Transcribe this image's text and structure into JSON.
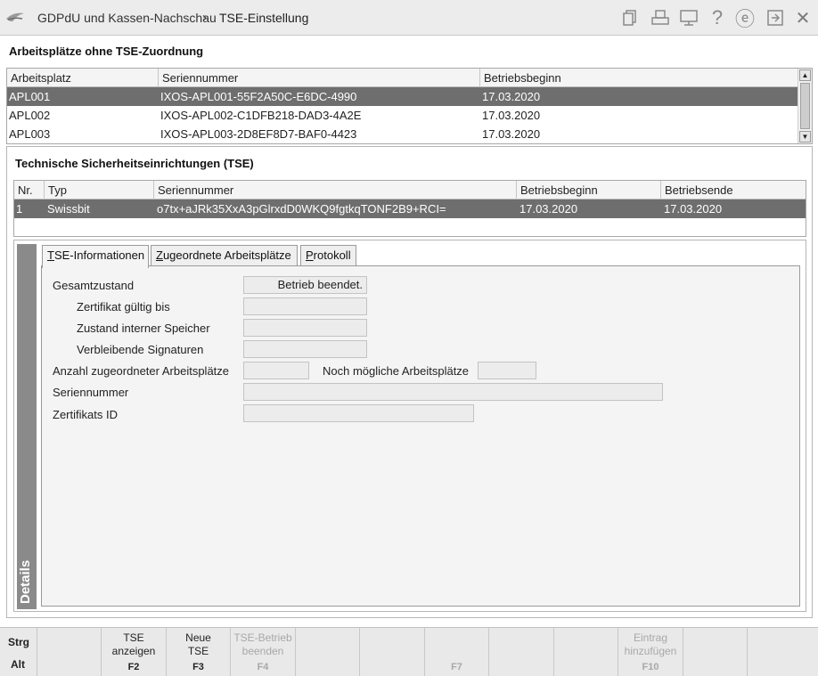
{
  "header": {
    "breadcrumb_parent": "GDPdU und Kassen-Nachschau",
    "breadcrumb_separator": "›",
    "breadcrumb_current": "TSE-Einstellung",
    "icons": [
      "documents-icon",
      "printer-icon",
      "monitor-icon",
      "help-icon",
      "e-icon",
      "export-icon",
      "close-icon"
    ],
    "help_glyph": "?",
    "e_glyph": "ⓔ",
    "close_glyph": "✕"
  },
  "workstations": {
    "title": "Arbeitsplätze ohne TSE-Zuordnung",
    "columns": [
      "Arbeitsplatz",
      "Seriennummer",
      "Betriebsbeginn"
    ],
    "rows": [
      {
        "workstation": "APL001",
        "serial": "IXOS-APL001-55F2A50C-E6DC-4990",
        "start": "17.03.2020",
        "selected": true
      },
      {
        "workstation": "APL002",
        "serial": "IXOS-APL002-C1DFB218-DAD3-4A2E",
        "start": "17.03.2020",
        "selected": false
      },
      {
        "workstation": "APL003",
        "serial": "IXOS-APL003-2D8EF8D7-BAF0-4423",
        "start": "17.03.2020",
        "selected": false
      }
    ]
  },
  "tse": {
    "title": "Technische Sicherheitseinrichtungen (TSE)",
    "columns": [
      "Nr.",
      "Typ",
      "Seriennummer",
      "Betriebsbeginn",
      "Betriebsende"
    ],
    "rows": [
      {
        "nr": "1",
        "type": "Swissbit",
        "serial": "o7tx+aJRk35XxA3pGlrxdD0WKQ9fgtkqTONF2B9+RCI=",
        "start": "17.03.2020",
        "end": "17.03.2020",
        "selected": true
      }
    ]
  },
  "details": {
    "strip_label": "Details",
    "tabs": [
      {
        "underline": "T",
        "rest": "SE-Informationen",
        "active": true
      },
      {
        "underline": "Z",
        "rest": "ugeordnete Arbeitsplätze",
        "active": false
      },
      {
        "underline": "P",
        "rest": "rotokoll",
        "active": false
      }
    ],
    "fields": {
      "overall_state_label": "Gesamtzustand",
      "overall_state_value": "Betrieb beendet.",
      "cert_valid_label": "Zertifikat gültig bis",
      "cert_valid_value": "",
      "memory_state_label": "Zustand interner Speicher",
      "memory_state_value": "",
      "remaining_signatures_label": "Verbleibende Signaturen",
      "remaining_signatures_value": "",
      "assigned_count_label": "Anzahl zugeordneter Arbeitsplätze",
      "assigned_count_value": "",
      "possible_count_label": "Noch mögliche Arbeitsplätze",
      "possible_count_value": "",
      "serial_label": "Seriennummer",
      "serial_value": "",
      "cert_id_label": "Zertifikats ID",
      "cert_id_value": ""
    }
  },
  "footer": {
    "modifier_top": "Strg",
    "modifier_bottom": "Alt",
    "keys": [
      {
        "line1": "",
        "line2": "",
        "key": "",
        "enabled": false
      },
      {
        "line1": "TSE",
        "line2": "anzeigen",
        "key": "F2",
        "enabled": true
      },
      {
        "line1": "Neue",
        "line2": "TSE",
        "key": "F3",
        "enabled": true
      },
      {
        "line1": "TSE-Betrieb",
        "line2": "beenden",
        "key": "F4",
        "enabled": false
      },
      {
        "line1": "",
        "line2": "",
        "key": "",
        "enabled": false
      },
      {
        "line1": "",
        "line2": "",
        "key": "",
        "enabled": false
      },
      {
        "line1": "",
        "line2": "",
        "key": "F7",
        "enabled": false
      },
      {
        "line1": "",
        "line2": "",
        "key": "",
        "enabled": false
      },
      {
        "line1": "",
        "line2": "",
        "key": "",
        "enabled": false
      },
      {
        "line1": "Eintrag",
        "line2": "hinzufügen",
        "key": "F10",
        "enabled": false
      },
      {
        "line1": "",
        "line2": "",
        "key": "",
        "enabled": false
      },
      {
        "line1": "",
        "line2": "",
        "key": "",
        "enabled": false
      }
    ]
  }
}
